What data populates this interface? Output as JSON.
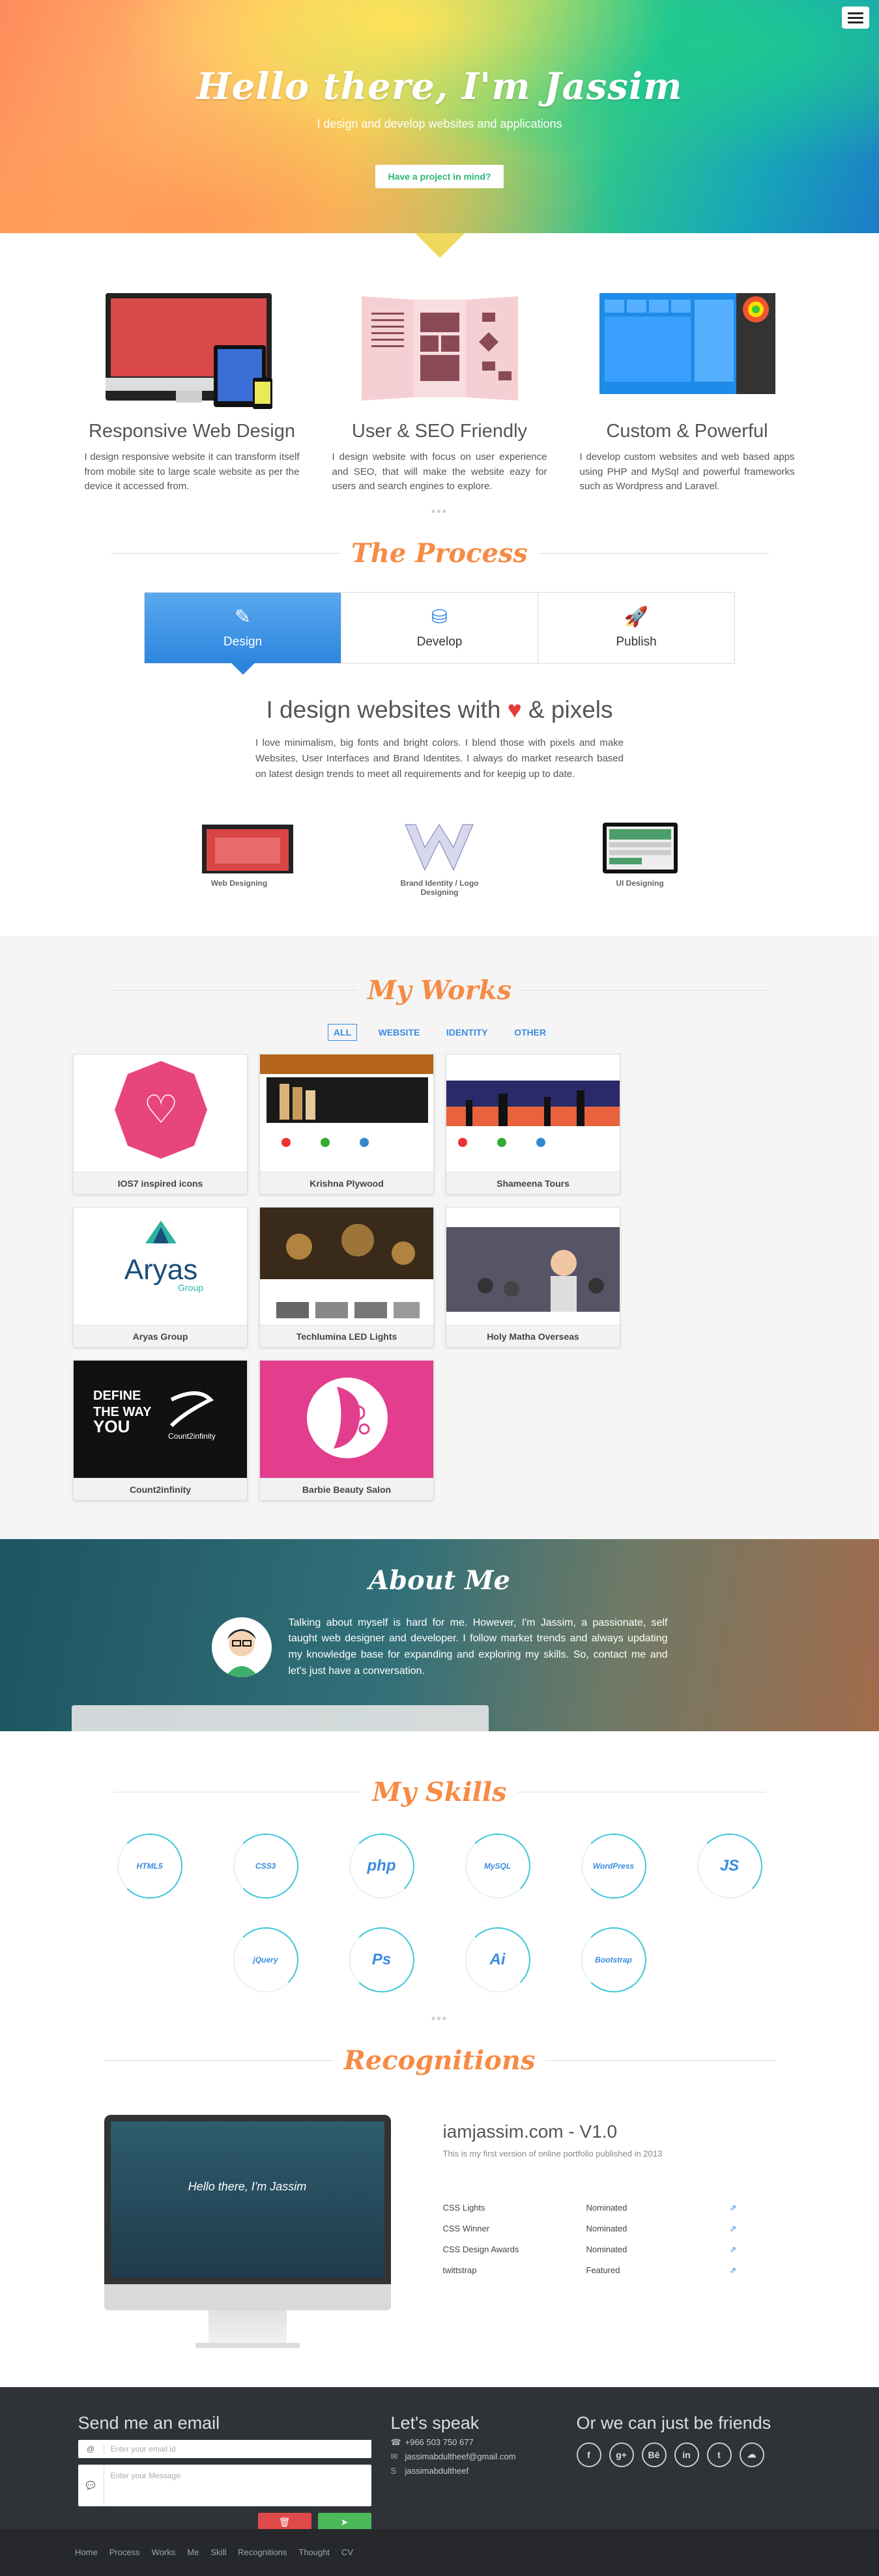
{
  "hero": {
    "title": "Hello there, I'm Jassim",
    "subtitle": "I design and develop websites and applications",
    "cta": "Have a project in mind?"
  },
  "features": [
    {
      "title": "Responsive Web Design",
      "text": "I design responsive website it can transform itself from mobile site to large scale website as per the device it accessed from."
    },
    {
      "title": "User & SEO Friendly",
      "text": "I design website with focus on user experience and SEO, that will make the website eazy for users and search engines to explore."
    },
    {
      "title": "Custom & Powerful",
      "text": "I develop custom websites and web based apps using PHP and MySql and powerful frameworks such as Wordpress and Laravel."
    }
  ],
  "process": {
    "title": "The Process",
    "tabs": [
      "Design",
      "Develop",
      "Publish"
    ],
    "headline_a": "I design websites with",
    "headline_b": "& pixels",
    "text": "I love minimalism, big fonts and bright colors. I blend those with pixels and make Websites, User Interfaces and Brand Identites. I always do market research based on latest design trends to meet all requirements and for keepig up to date.",
    "items": [
      "Web Designing",
      "Brand Identity / Logo Designing",
      "UI Designing"
    ]
  },
  "works": {
    "title": "My Works",
    "filters": [
      "ALL",
      "WEBSITE",
      "IDENTITY",
      "OTHER"
    ],
    "items": [
      "IOS7 inspired icons",
      "Krishna Plywood",
      "Shameena Tours",
      "Aryas Group",
      "Techlumina LED Lights",
      "Holy Matha Overseas",
      "Count2infinity",
      "Barbie Beauty Salon"
    ],
    "aryas_logo": "Aryas",
    "aryas_sub": "Group",
    "count_text": "DEFINE THE WAY YOU",
    "count_logo": "Count2infinity"
  },
  "about": {
    "title": "About Me",
    "text": "Talking about myself is hard for me. However, I'm Jassim, a passionate, self taught web designer and developer. I follow market trends and always updating my knowledge base for expanding and exploring my skills. So, contact me and let's just have a conversation."
  },
  "skills": {
    "title": "My Skills",
    "items": [
      "HTML5",
      "CSS3",
      "php",
      "MySQL",
      "WordPress",
      "JS",
      "jQuery",
      "Ps",
      "Ai",
      "Bootstrap"
    ]
  },
  "recognitions": {
    "title": "Recognitions",
    "site": "iamjassim.com - V1.0",
    "desc": "This is my first version of online portfolio published in 2013",
    "screen_title": "Hello there, I'm Jassim",
    "rows": [
      {
        "name": "CSS Lights",
        "status": "Nominated"
      },
      {
        "name": "CSS Winner",
        "status": "Nominated"
      },
      {
        "name": "CSS Design Awards",
        "status": "Nominated"
      },
      {
        "name": "twittstrap",
        "status": "Featured"
      }
    ]
  },
  "footer": {
    "email_title": "Send me an email",
    "email_ph": "Enter your email id",
    "msg_ph": "Enter your Message",
    "speak_title": "Let's speak",
    "phone": "+966 503 750 677",
    "email": "jassimabdultheef@gmail.com",
    "skype": "jassimabdultheef",
    "friends_title": "Or we can just be friends",
    "social": [
      "f",
      "g+",
      "Bē",
      "in",
      "t",
      "☁"
    ],
    "nav": [
      "Home",
      "Process",
      "Works",
      "Me",
      "Skill",
      "Recognitions",
      "Thought",
      "CV"
    ]
  }
}
